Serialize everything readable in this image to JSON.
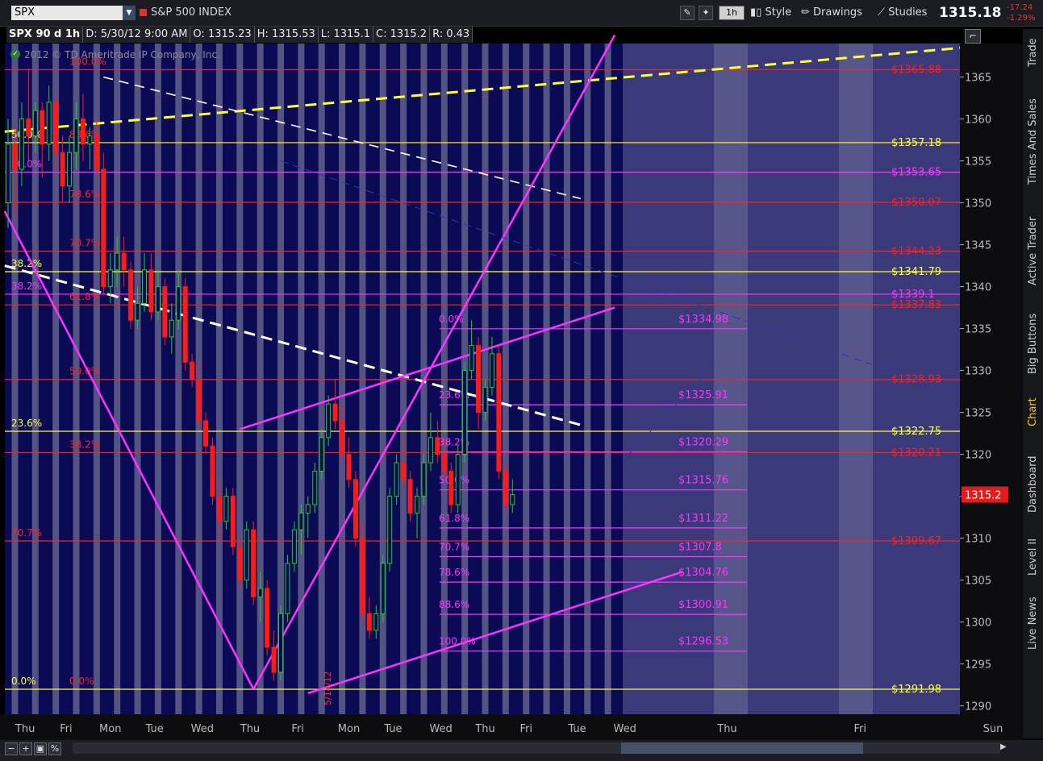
{
  "toolbar": {
    "symbol": "SPX",
    "index_name": "S&P 500 INDEX",
    "interval_label": "1h",
    "style_label": "Style",
    "drawings_label": "Drawings",
    "studies_label": "Studies",
    "last_price": "1315.18",
    "change_abs": "-17.24",
    "change_pct": "-1.29%"
  },
  "infobar": {
    "period": "SPX 90 d 1h",
    "date": "D: 5/30/12 9:00 AM",
    "open": "O: 1315.23",
    "high": "H: 1315.53",
    "low": "L: 1315.1",
    "close": "C: 1315.2",
    "range": "R: 0.43"
  },
  "copyright": "2012 © TD Ameritrade IP Company, Inc.",
  "side_tabs": [
    "Trade",
    "Times And Sales",
    "Active Trader",
    "Big Buttons",
    "Chart",
    "Dashboard",
    "Level II",
    "Live News"
  ],
  "colors": {
    "background": "#0b0b55",
    "session_band": "#6c6c94",
    "future_area": "#3a3a7a",
    "red": "#ff2020",
    "magenta": "#ff33ff",
    "yellow": "#ffff33",
    "orange": "#ffaa00",
    "white": "#ffffff",
    "up_candle": "#22cc22",
    "down_candle": "#ff1a1a",
    "accent_tab": "#ffcc00"
  },
  "chart_data": {
    "type": "candlestick",
    "ylim": [
      1289,
      1369
    ],
    "y_ticks": [
      1290,
      1295,
      1300,
      1305,
      1310,
      1315,
      1320,
      1325,
      1330,
      1335,
      1340,
      1345,
      1350,
      1355,
      1360,
      1365
    ],
    "x_ticks": [
      {
        "label": "Thu",
        "x": 2.5
      },
      {
        "label": "Fri",
        "x": 8.5
      },
      {
        "label": "Mon",
        "x": 15
      },
      {
        "label": "Tue",
        "x": 21.5
      },
      {
        "label": "Wed",
        "x": 28.5
      },
      {
        "label": "Thu",
        "x": 35.5
      },
      {
        "label": "Fri",
        "x": 42.5
      },
      {
        "label": "Mon",
        "x": 50
      },
      {
        "label": "Tue",
        "x": 56.5
      },
      {
        "label": "Wed",
        "x": 63.5
      },
      {
        "label": "Thu",
        "x": 70
      },
      {
        "label": "Fri",
        "x": 76
      },
      {
        "label": "Tue",
        "x": 83.5
      },
      {
        "label": "Wed",
        "x": 90.5
      },
      {
        "label": "Thu",
        "x": 105.5
      },
      {
        "label": "Fri",
        "x": 125
      },
      {
        "label": "Sun",
        "x": 144.5
      }
    ],
    "candles": [
      [
        1350,
        1360,
        1347,
        1357
      ],
      [
        1357,
        1359,
        1348,
        1354
      ],
      [
        1354,
        1362,
        1352,
        1360
      ],
      [
        1360,
        1366,
        1355,
        1358
      ],
      [
        1358,
        1362,
        1356,
        1361
      ],
      [
        1361,
        1362,
        1353,
        1357
      ],
      [
        1357,
        1364,
        1355,
        1362
      ],
      [
        1362,
        1363,
        1354,
        1356
      ],
      [
        1356,
        1358,
        1350,
        1352
      ],
      [
        1352,
        1358,
        1350,
        1356
      ],
      [
        1356,
        1362,
        1354,
        1360
      ],
      [
        1360,
        1363,
        1355,
        1357
      ],
      [
        1357,
        1359,
        1354,
        1358
      ],
      [
        1358,
        1360,
        1353,
        1354
      ],
      [
        1354,
        1356,
        1339,
        1340
      ],
      [
        1340,
        1344,
        1338,
        1342
      ],
      [
        1342,
        1346,
        1340,
        1344
      ],
      [
        1344,
        1346,
        1340,
        1342
      ],
      [
        1342,
        1343,
        1335,
        1336
      ],
      [
        1336,
        1340,
        1335,
        1338
      ],
      [
        1338,
        1344,
        1337,
        1342
      ],
      [
        1342,
        1344,
        1336,
        1337
      ],
      [
        1337,
        1342,
        1336,
        1340
      ],
      [
        1340,
        1341,
        1333,
        1334
      ],
      [
        1334,
        1338,
        1332,
        1336
      ],
      [
        1336,
        1342,
        1335,
        1340
      ],
      [
        1340,
        1341,
        1330,
        1331
      ],
      [
        1331,
        1332,
        1328,
        1329
      ],
      [
        1329,
        1331,
        1323,
        1324
      ],
      [
        1324,
        1325,
        1320,
        1321
      ],
      [
        1321,
        1322,
        1314,
        1315
      ],
      [
        1315,
        1317,
        1310,
        1312
      ],
      [
        1312,
        1316,
        1311,
        1315
      ],
      [
        1315,
        1316,
        1308,
        1309
      ],
      [
        1309,
        1310,
        1304,
        1305
      ],
      [
        1305,
        1312,
        1304,
        1311
      ],
      [
        1311,
        1312,
        1302,
        1303
      ],
      [
        1303,
        1306,
        1300,
        1304
      ],
      [
        1304,
        1305,
        1296,
        1297
      ],
      [
        1297,
        1299,
        1293,
        1294
      ],
      [
        1294,
        1302,
        1293,
        1301
      ],
      [
        1301,
        1308,
        1300,
        1307
      ],
      [
        1307,
        1312,
        1306,
        1311
      ],
      [
        1311,
        1314,
        1308,
        1313
      ],
      [
        1313,
        1315,
        1310,
        1314
      ],
      [
        1314,
        1319,
        1313,
        1318
      ],
      [
        1318,
        1323,
        1317,
        1322
      ],
      [
        1322,
        1327,
        1321,
        1326
      ],
      [
        1326,
        1329,
        1323,
        1324
      ],
      [
        1324,
        1326,
        1319,
        1320
      ],
      [
        1320,
        1322,
        1316,
        1317
      ],
      [
        1317,
        1318,
        1309,
        1310
      ],
      [
        1310,
        1312,
        1300,
        1301
      ],
      [
        1301,
        1303,
        1298,
        1299
      ],
      [
        1299,
        1302,
        1298,
        1301
      ],
      [
        1301,
        1308,
        1300,
        1307
      ],
      [
        1307,
        1316,
        1306,
        1315
      ],
      [
        1315,
        1320,
        1314,
        1319
      ],
      [
        1319,
        1322,
        1316,
        1317
      ],
      [
        1317,
        1318,
        1312,
        1313
      ],
      [
        1313,
        1316,
        1310,
        1315
      ],
      [
        1315,
        1320,
        1314,
        1319
      ],
      [
        1319,
        1325,
        1318,
        1322
      ],
      [
        1322,
        1324,
        1319,
        1320
      ],
      [
        1320,
        1322,
        1317,
        1318
      ],
      [
        1318,
        1319,
        1313,
        1314
      ],
      [
        1314,
        1321,
        1313,
        1320
      ],
      [
        1320,
        1331,
        1319,
        1330
      ],
      [
        1330,
        1336,
        1329,
        1333
      ],
      [
        1333,
        1334,
        1323,
        1325
      ],
      [
        1325,
        1329,
        1324,
        1328
      ],
      [
        1328,
        1334,
        1327,
        1332
      ],
      [
        1332,
        1333,
        1317,
        1318
      ],
      [
        1318,
        1319,
        1313,
        1314
      ],
      [
        1314,
        1317,
        1313,
        1315.2
      ]
    ],
    "fib_levels": [
      {
        "price": 1365.88,
        "label": "$1365.88",
        "color": "red"
      },
      {
        "price": 1357.18,
        "label": "$1357.18",
        "color": "yellow"
      },
      {
        "price": 1353.65,
        "label": "$1353.65",
        "color": "magenta"
      },
      {
        "price": 1350.07,
        "label": "$1350.07",
        "color": "red"
      },
      {
        "price": 1344.23,
        "label": "$1344.23",
        "color": "red"
      },
      {
        "price": 1341.79,
        "label": "$1341.79",
        "color": "yellow"
      },
      {
        "price": 1339.1,
        "label": "$1339.1",
        "color": "magenta"
      },
      {
        "price": 1337.83,
        "label": "$1337.83",
        "color": "red"
      },
      {
        "price": 1328.93,
        "label": "$1328.93",
        "color": "red"
      },
      {
        "price": 1322.75,
        "label": "$1322.75",
        "color": "yellow"
      },
      {
        "price": 1320.21,
        "label": "$1320.21",
        "color": "red"
      },
      {
        "price": 1309.67,
        "label": "$1309.67",
        "color": "red"
      },
      {
        "price": 1291.98,
        "label": "$1291.98",
        "color": "yellow"
      }
    ],
    "fib_inner": [
      {
        "price": 1334.98,
        "pct": "0.0%",
        "label": "$1334.98"
      },
      {
        "price": 1325.91,
        "pct": "23.6%",
        "label": "$1325.91"
      },
      {
        "price": 1320.29,
        "pct": "38.2%",
        "label": "$1320.29"
      },
      {
        "price": 1315.76,
        "pct": "50.0%",
        "label": "$1315.76"
      },
      {
        "price": 1311.22,
        "pct": "61.8%",
        "label": "$1311.22"
      },
      {
        "price": 1307.8,
        "pct": "70.7%",
        "label": "$1307.8"
      },
      {
        "price": 1304.76,
        "pct": "78.6%",
        "label": "$1304.76"
      },
      {
        "price": 1300.91,
        "pct": "88.6%",
        "label": "$1300.91"
      },
      {
        "price": 1296.53,
        "pct": "100.0%",
        "label": "$1296.53"
      }
    ],
    "pct_labels_left": [
      {
        "price": 1357.18,
        "text": "50.0%",
        "color": "yellow",
        "col": "a"
      },
      {
        "price": 1353.65,
        "text": "50.0%",
        "color": "magenta",
        "col": "a"
      },
      {
        "price": 1341.79,
        "text": "38.2%",
        "color": "yellow",
        "col": "a"
      },
      {
        "price": 1339.1,
        "text": "38.2%",
        "color": "magenta",
        "col": "a"
      },
      {
        "price": 1322.75,
        "text": "23.6%",
        "color": "yellow",
        "col": "a"
      },
      {
        "price": 1309.67,
        "text": "70.7%",
        "color": "red",
        "col": "a"
      },
      {
        "price": 1291.98,
        "text": "0.0%",
        "color": "yellow",
        "col": "a"
      },
      {
        "price": 1365.88,
        "text": "100.0%",
        "color": "red",
        "col": "b"
      },
      {
        "price": 1357.18,
        "text": "88.6%",
        "color": "red",
        "col": "b"
      },
      {
        "price": 1350.07,
        "text": "78.6%",
        "color": "red",
        "col": "b"
      },
      {
        "price": 1344.23,
        "text": "70.7%",
        "color": "red",
        "col": "b"
      },
      {
        "price": 1337.83,
        "text": "61.8%",
        "color": "red",
        "col": "b"
      },
      {
        "price": 1328.93,
        "text": "50.0%",
        "color": "red",
        "col": "b"
      },
      {
        "price": 1320.21,
        "text": "38.2%",
        "color": "red",
        "col": "b"
      },
      {
        "price": 1291.98,
        "text": "0.0%",
        "color": "red",
        "col": "b"
      }
    ],
    "last_price_label": "1315.2",
    "last_price": 1315.2,
    "vertical_note": "5/14/12"
  }
}
